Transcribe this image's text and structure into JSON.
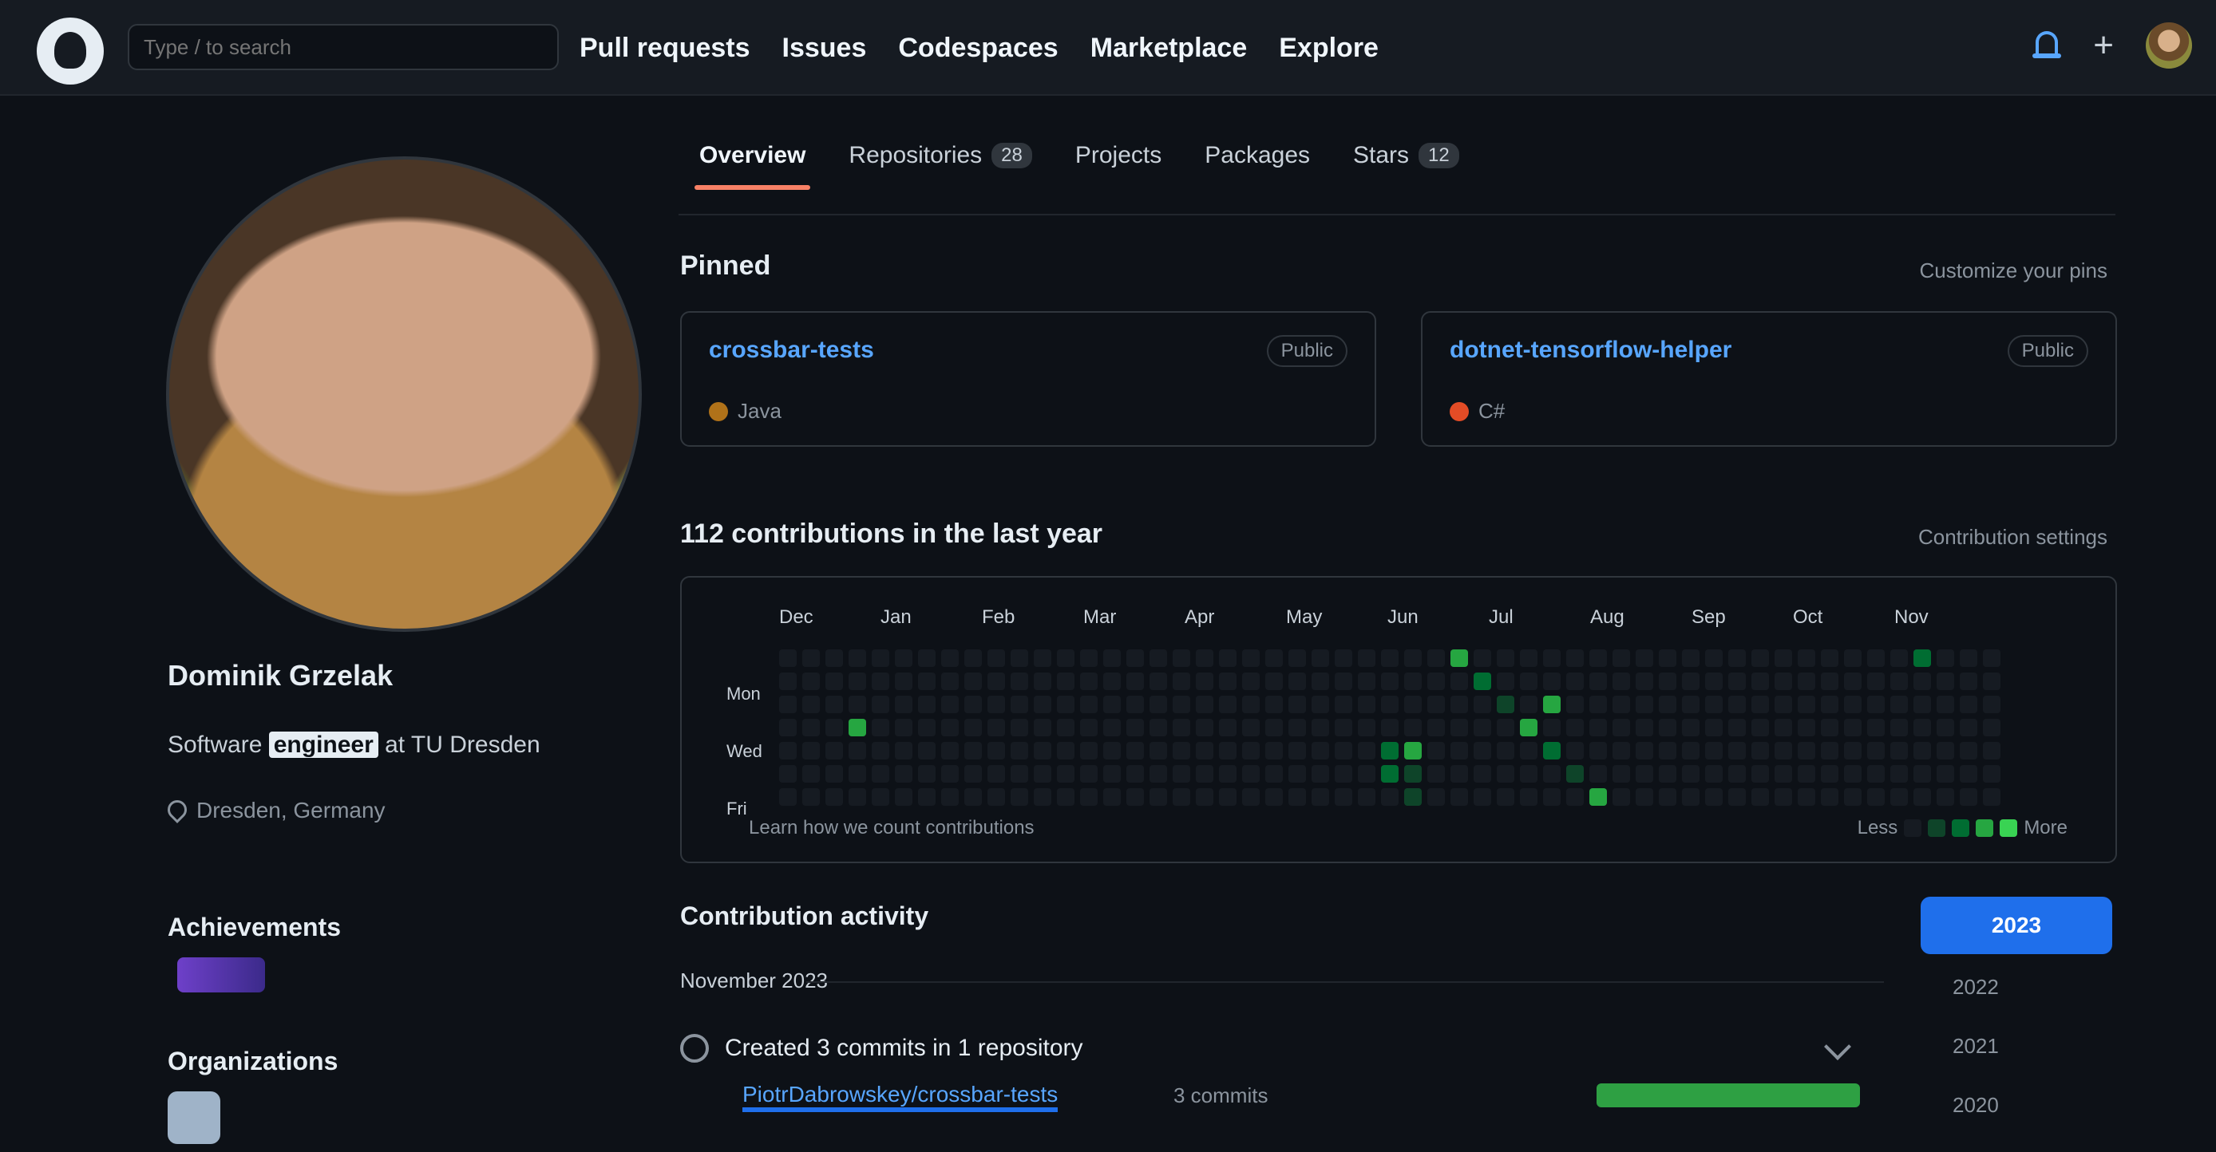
{
  "header": {
    "search_placeholder": "Type / to search",
    "nav": [
      "Pull requests",
      "Issues",
      "Codespaces",
      "Marketplace",
      "Explore"
    ]
  },
  "profile": {
    "name": "Dominik Grzelak",
    "bio_pre": "Software",
    "bio_highlight": "engineer",
    "bio_post": " at TU Dresden",
    "location": "Dresden, Germany",
    "achievements_title": "Achievements",
    "organizations_title": "Organizations"
  },
  "tabs": [
    {
      "label": "Overview",
      "count": ""
    },
    {
      "label": "Repositories",
      "count": "28"
    },
    {
      "label": "Projects",
      "count": ""
    },
    {
      "label": "Packages",
      "count": ""
    },
    {
      "label": "Stars",
      "count": "12"
    }
  ],
  "pinned": {
    "title": "Pinned",
    "customize": "Customize your pins",
    "repos": [
      {
        "name": "crossbar-tests",
        "visibility": "Public",
        "language": "Java",
        "lang_color": "#b07219"
      },
      {
        "name": "dotnet-tensorflow-helper",
        "visibility": "Public",
        "language": "C#",
        "lang_color": "#e34c26"
      }
    ]
  },
  "contributions": {
    "title": "112 contributions in the last year",
    "settings": "Contribution settings",
    "months": [
      "Dec",
      "Jan",
      "Feb",
      "Mar",
      "Apr",
      "May",
      "Jun",
      "Jul",
      "Aug",
      "Sep",
      "Oct",
      "Nov"
    ],
    "days": [
      "Mon",
      "Wed",
      "Fri"
    ],
    "footer": "Learn how we count contributions",
    "legend_less": "Less",
    "legend_more": "More",
    "legend_colors": [
      "#161b22",
      "#0e4429",
      "#006d32",
      "#26a641",
      "#39d353"
    ]
  },
  "activity": {
    "title": "Contribution activity",
    "year_button": "2023",
    "years": [
      "2022",
      "2021",
      "2020"
    ],
    "month": "November 2023",
    "item_text": "Created 3 commits in 1 repository",
    "item_repo": "PiotrDabrowskey/crossbar-tests",
    "item_count": "3 commits",
    "bar_color": "#2ea043"
  }
}
